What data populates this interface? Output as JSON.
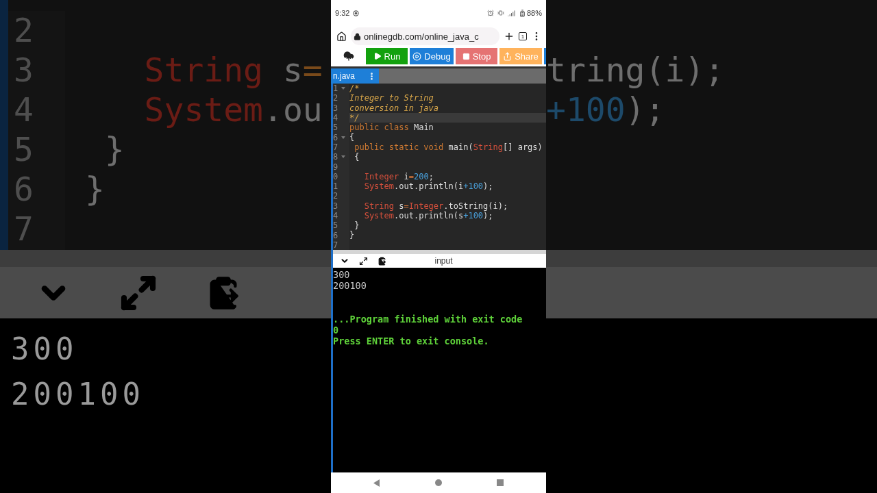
{
  "backdrop_left": {
    "lines": [
      {
        "number": "2"
      },
      {
        "number": "3",
        "tokens": [
          {
            "kind": "type",
            "text": "    String"
          },
          {
            "kind": "plain",
            "text": " s"
          },
          {
            "kind": "op",
            "text": "="
          }
        ]
      },
      {
        "number": "4",
        "tokens": [
          {
            "kind": "type",
            "text": "    System"
          },
          {
            "kind": "plain",
            "text": ".ou"
          }
        ]
      },
      {
        "number": "5",
        "tokens": [
          {
            "kind": "plain",
            "text": "  }"
          }
        ]
      },
      {
        "number": "6",
        "tokens": [
          {
            "kind": "plain",
            "text": " }"
          }
        ]
      },
      {
        "number": "7"
      }
    ],
    "console": [
      "300",
      "200100"
    ]
  },
  "phone": {
    "status_bar": {
      "time": "9:32",
      "battery": "88%"
    },
    "address_bar": {
      "url": "onlinegdb.com/online_java_c",
      "tab_count": "1"
    },
    "toolbar": [
      {
        "kind": "upload",
        "color": "#ffffff"
      },
      {
        "kind": "run",
        "label": "Run",
        "color": "#13a10e"
      },
      {
        "kind": "debug",
        "label": "Debug",
        "color": "#1e7fd8"
      },
      {
        "kind": "stop",
        "label": "Stop",
        "color": "#e57373"
      },
      {
        "kind": "share",
        "label": "Share",
        "color": "#ffb35c"
      },
      {
        "kind": "cut",
        "color": "#1e7fd8"
      }
    ],
    "file_tab": {
      "label": "n.java",
      "selected": true
    },
    "editor": {
      "lines": [
        {
          "number": "1",
          "foldable": true,
          "highlighted": false,
          "tokens": [
            {
              "kind": "comment",
              "text": "/*"
            }
          ]
        },
        {
          "number": "2",
          "foldable": false,
          "highlighted": false,
          "tokens": [
            {
              "kind": "comment",
              "text": "Integer to String"
            }
          ]
        },
        {
          "number": "3",
          "foldable": false,
          "highlighted": false,
          "tokens": [
            {
              "kind": "comment",
              "text": "conversion in java"
            }
          ]
        },
        {
          "number": "4",
          "foldable": false,
          "highlighted": true,
          "tokens": [
            {
              "kind": "comment",
              "text": "*/"
            }
          ]
        },
        {
          "number": "5",
          "foldable": false,
          "highlighted": false,
          "tokens": [
            {
              "kind": "keyword",
              "text": "public class"
            },
            {
              "kind": "plain",
              "text": " Main"
            }
          ]
        },
        {
          "number": "6",
          "foldable": true,
          "highlighted": false,
          "tokens": [
            {
              "kind": "plain",
              "text": "{"
            }
          ]
        },
        {
          "number": "7",
          "foldable": false,
          "highlighted": false,
          "tokens": [
            {
              "kind": "keyword",
              "text": " public static void"
            },
            {
              "kind": "plain",
              "text": " main("
            },
            {
              "kind": "type",
              "text": "String"
            },
            {
              "kind": "plain",
              "text": "[] args)"
            }
          ]
        },
        {
          "number": "8",
          "foldable": true,
          "highlighted": false,
          "tokens": [
            {
              "kind": "plain",
              "text": " {"
            }
          ]
        },
        {
          "number": "9",
          "foldable": false,
          "highlighted": false
        },
        {
          "number": "0",
          "foldable": false,
          "highlighted": false,
          "tokens": [
            {
              "kind": "type",
              "text": "   Integer"
            },
            {
              "kind": "plain",
              "text": " i"
            },
            {
              "kind": "op",
              "text": "="
            },
            {
              "kind": "number",
              "text": "200"
            },
            {
              "kind": "plain",
              "text": ";"
            }
          ]
        },
        {
          "number": "1",
          "foldable": false,
          "highlighted": false,
          "tokens": [
            {
              "kind": "type",
              "text": "   System"
            },
            {
              "kind": "plain",
              "text": ".out.println(i"
            },
            {
              "kind": "number",
              "text": "+100"
            },
            {
              "kind": "plain",
              "text": ");"
            }
          ]
        },
        {
          "number": "2",
          "foldable": false,
          "highlighted": false
        },
        {
          "number": "3",
          "foldable": false,
          "highlighted": false,
          "tokens": [
            {
              "kind": "type",
              "text": "   String"
            },
            {
              "kind": "plain",
              "text": " s"
            },
            {
              "kind": "op",
              "text": "="
            },
            {
              "kind": "type",
              "text": "Integer"
            },
            {
              "kind": "plain",
              "text": ".toString(i);"
            }
          ]
        },
        {
          "number": "4",
          "foldable": false,
          "highlighted": false,
          "tokens": [
            {
              "kind": "type",
              "text": "   System"
            },
            {
              "kind": "plain",
              "text": ".out.println(s"
            },
            {
              "kind": "number",
              "text": "+100"
            },
            {
              "kind": "plain",
              "text": ");"
            }
          ]
        },
        {
          "number": "5",
          "foldable": false,
          "highlighted": false,
          "tokens": [
            {
              "kind": "plain",
              "text": " }"
            }
          ]
        },
        {
          "number": "6",
          "foldable": false,
          "highlighted": false,
          "tokens": [
            {
              "kind": "plain",
              "text": "}"
            }
          ]
        },
        {
          "number": "7",
          "foldable": false,
          "highlighted": false
        }
      ]
    },
    "console_header": {
      "label": "input"
    },
    "console": [
      {
        "kind": "output",
        "text": "300"
      },
      {
        "kind": "output",
        "text": "200100"
      },
      {
        "kind": "gap"
      },
      {
        "kind": "gap"
      },
      {
        "kind": "status",
        "text": "...Program finished with exit code"
      },
      {
        "kind": "status",
        "text": "0"
      },
      {
        "kind": "status",
        "text": "Press ENTER to exit console."
      }
    ]
  },
  "backdrop_right": {
    "lines": [
      {
        "tokens": [
          {
            "kind": "plain",
            "text": "tring(i);"
          }
        ]
      },
      {
        "tokens": [
          {
            "kind": "number",
            "text": "+100"
          },
          {
            "kind": "plain",
            "text": ");"
          }
        ]
      }
    ]
  }
}
